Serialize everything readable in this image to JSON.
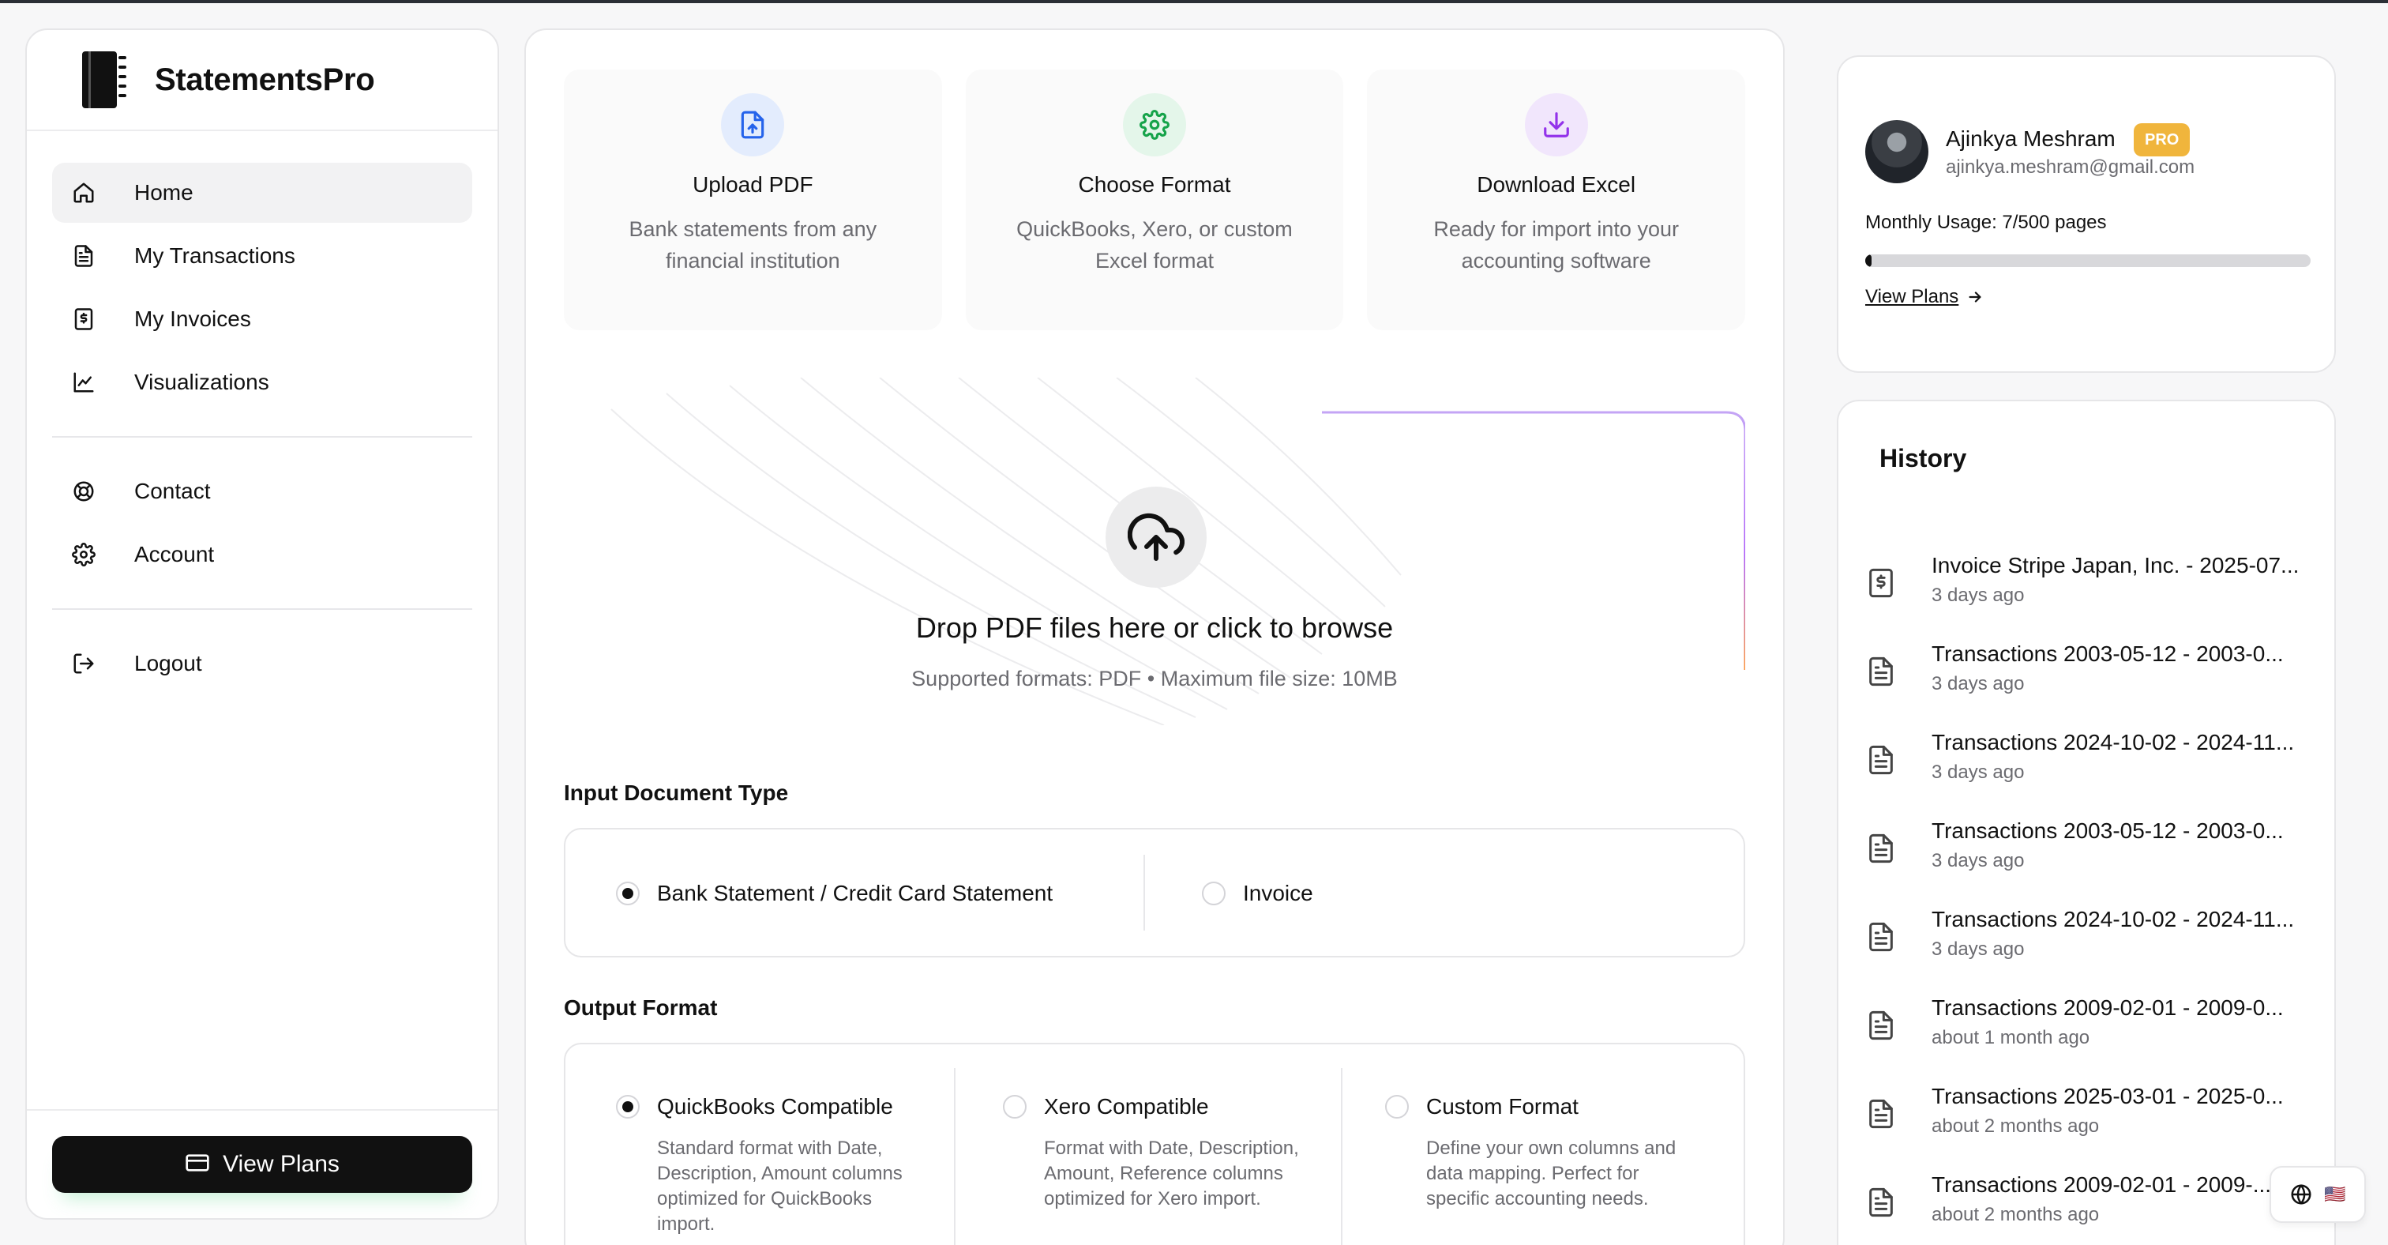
{
  "app": {
    "name": "StatementsPro"
  },
  "sidebar": {
    "items": [
      {
        "label": "Home",
        "icon": "home-icon",
        "active": true
      },
      {
        "label": "My Transactions",
        "icon": "file-text-icon"
      },
      {
        "label": "My Invoices",
        "icon": "invoice-icon"
      },
      {
        "label": "Visualizations",
        "icon": "chart-icon"
      },
      {
        "label": "Contact",
        "icon": "lifebuoy-icon"
      },
      {
        "label": "Account",
        "icon": "gear-icon"
      },
      {
        "label": "Logout",
        "icon": "logout-icon"
      }
    ],
    "view_plans_label": "View Plans"
  },
  "steps": [
    {
      "title": "Upload PDF",
      "desc": "Bank statements from any financial institution",
      "icon": "upload-file-icon",
      "color": "#2563eb"
    },
    {
      "title": "Choose Format",
      "desc": "QuickBooks, Xero, or custom Excel format",
      "icon": "gear-icon",
      "color": "#16a34a"
    },
    {
      "title": "Download Excel",
      "desc": "Ready for import into your accounting software",
      "icon": "download-icon",
      "color": "#9333ea"
    }
  ],
  "dropzone": {
    "title": "Drop PDF files here or click to browse",
    "subtitle": "Supported formats: PDF • Maximum file size: 10MB"
  },
  "input_type": {
    "label": "Input Document Type",
    "options": [
      {
        "label": "Bank Statement / Credit Card Statement",
        "selected": true
      },
      {
        "label": "Invoice",
        "selected": false
      }
    ]
  },
  "output_format": {
    "label": "Output Format",
    "options": [
      {
        "label": "QuickBooks Compatible",
        "desc": "Standard format with Date, Description, Amount columns optimized for QuickBooks import.",
        "selected": true
      },
      {
        "label": "Xero Compatible",
        "desc": "Format with Date, Description, Amount, Reference columns optimized for Xero import.",
        "selected": false
      },
      {
        "label": "Custom Format",
        "desc": "Define your own columns and data mapping. Perfect for specific accounting needs.",
        "selected": false
      }
    ]
  },
  "profile": {
    "name": "Ajinkya Meshram",
    "badge": "PRO",
    "email": "ajinkya.meshram@gmail.com",
    "usage_text": "Monthly Usage: 7/500 pages",
    "usage_fraction": 0.014,
    "view_plans_label": "View Plans"
  },
  "history": {
    "title": "History",
    "items": [
      {
        "title": "Invoice Stripe Japan, Inc. - 2025-07...",
        "time": "3 days ago",
        "icon": "invoice-icon"
      },
      {
        "title": "Transactions 2003-05-12 - 2003-0...",
        "time": "3 days ago",
        "icon": "file-text-icon"
      },
      {
        "title": "Transactions 2024-10-02 - 2024-11...",
        "time": "3 days ago",
        "icon": "file-text-icon"
      },
      {
        "title": "Transactions 2003-05-12 - 2003-0...",
        "time": "3 days ago",
        "icon": "file-text-icon"
      },
      {
        "title": "Transactions 2024-10-02 - 2024-11...",
        "time": "3 days ago",
        "icon": "file-text-icon"
      },
      {
        "title": "Transactions 2009-02-01 - 2009-0...",
        "time": "about 1 month ago",
        "icon": "file-text-icon"
      },
      {
        "title": "Transactions 2025-03-01 - 2025-0...",
        "time": "about 2 months ago",
        "icon": "file-text-icon"
      },
      {
        "title": "Transactions 2009-02-01 - 2009-...",
        "time": "about 2 months ago",
        "icon": "file-text-icon"
      }
    ]
  },
  "language": {
    "icon": "globe-icon",
    "flag": "🇺🇸"
  }
}
